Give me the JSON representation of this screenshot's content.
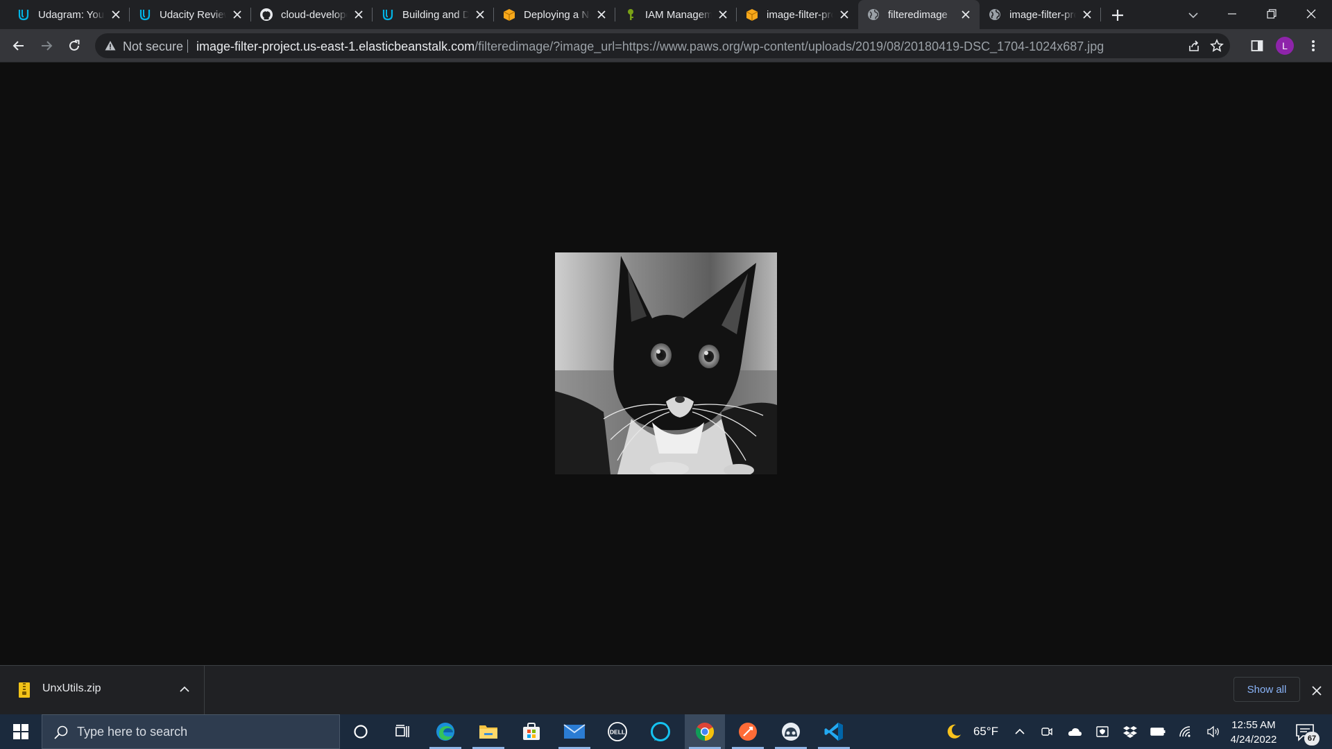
{
  "browser": {
    "tabs": [
      {
        "title": "Udagram: Your",
        "favicon": "udacity-icon"
      },
      {
        "title": "Udacity Reviews",
        "favicon": "udacity-icon"
      },
      {
        "title": "cloud-developer",
        "favicon": "github-icon"
      },
      {
        "title": "Building and Deploying",
        "favicon": "udacity-icon"
      },
      {
        "title": "Deploying a Node",
        "favicon": "aws-box-icon"
      },
      {
        "title": "IAM Management",
        "favicon": "iam-key-icon"
      },
      {
        "title": "image-filter-project",
        "favicon": "aws-box-icon"
      },
      {
        "title": "filteredimage",
        "favicon": "globe-icon",
        "active": true
      },
      {
        "title": "image-filter-project",
        "favicon": "globe-icon"
      }
    ],
    "toolbar": {
      "security_label": "Not secure",
      "url_host": "image-filter-project.us-east-1.elasticbeanstalk.com",
      "url_path": "/filteredimage/?image_url=https://www.paws.org/wp-content/uploads/2019/08/20180419-DSC_1704-1024x687.jpg",
      "profile_initial": "L"
    },
    "download_bar": {
      "file_name": "UnxUtils.zip",
      "show_all_label": "Show all"
    }
  },
  "page": {
    "image_description": "grayscale filtered photo of a black and white cat"
  },
  "taskbar": {
    "search_placeholder": "Type here to search",
    "weather": "65°F",
    "time": "12:55 AM",
    "date": "4/24/2022",
    "notification_count": "67",
    "pinned_apps": [
      "cortana-icon",
      "task-view-icon",
      "edge-icon",
      "file-explorer-icon",
      "microsoft-store-icon",
      "mail-icon",
      "dell-icon",
      "alexa-icon",
      "chrome-icon",
      "postman-icon",
      "app-icon",
      "vscode-icon"
    ]
  },
  "colors": {
    "tab_strip": "#202124",
    "active_tab": "#35363a",
    "page_background": "#0e0e0e",
    "taskbar": "#1b2a3d",
    "show_all_link": "#8ab4f8",
    "avatar": "#8e24aa"
  }
}
